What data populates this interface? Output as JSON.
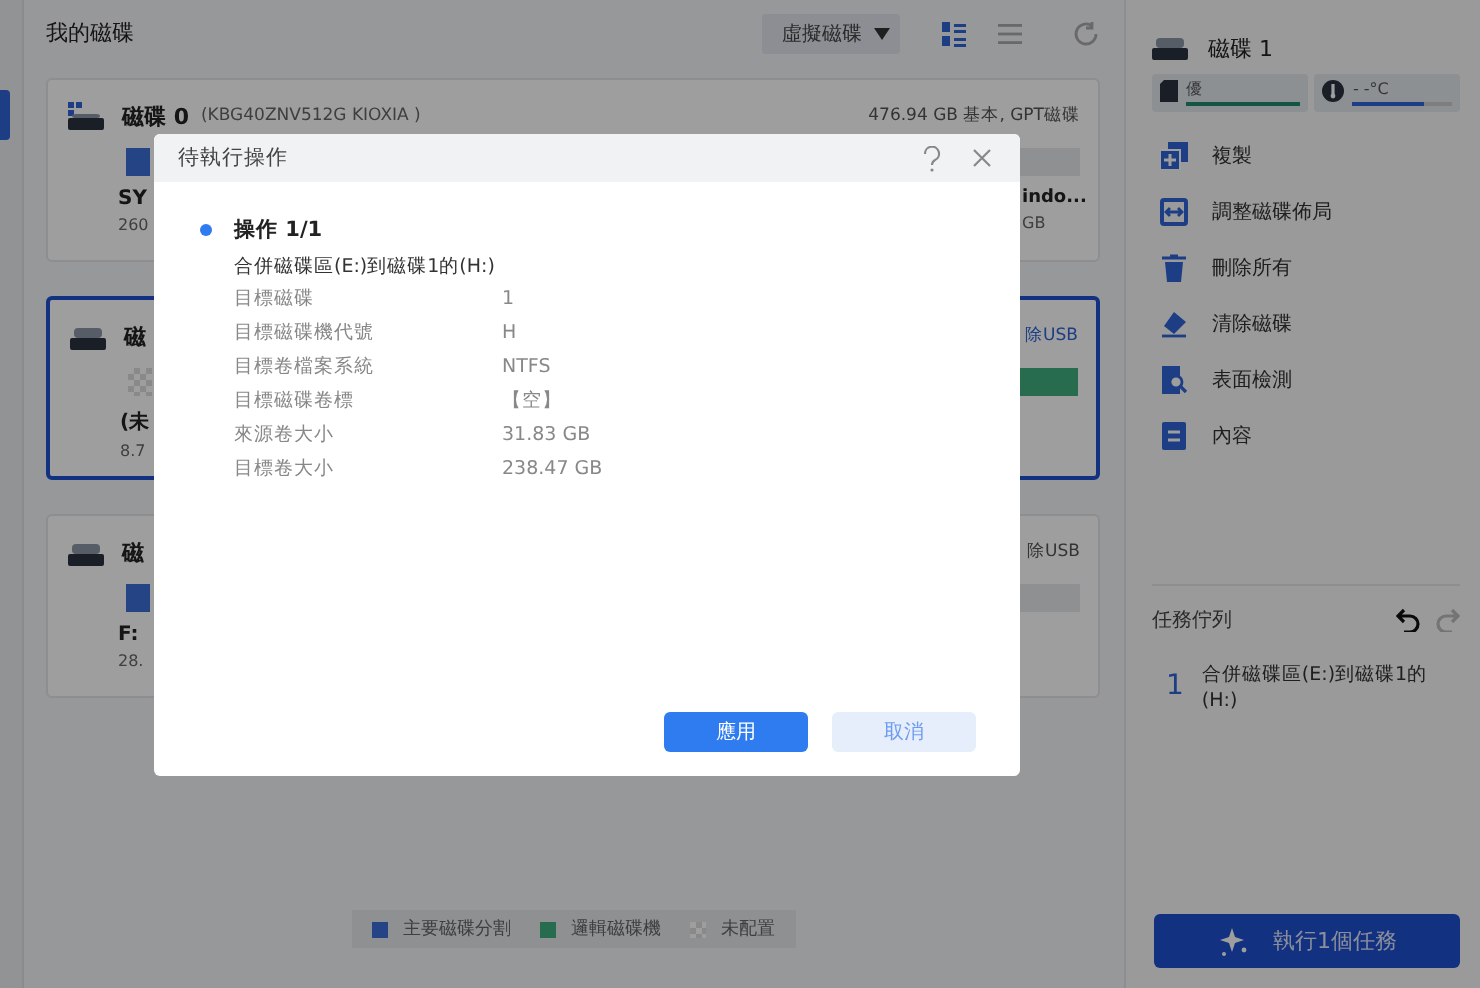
{
  "main": {
    "title": "我的磁碟",
    "view_dropdown": "虛擬磁碟",
    "view_modes": [
      {
        "selected": true
      },
      {
        "selected": false
      }
    ]
  },
  "disks": [
    {
      "name": "磁碟 0",
      "model": "(KBG40ZNV512G KIOXIA )",
      "info": "476.94 GB 基本, GPT磁碟",
      "info_link": false,
      "selected": false,
      "left": {
        "kind": "primary",
        "name": "SY",
        "size": "260"
      },
      "right": {
        "kind": "other",
        "name": "indo...",
        "size": "GB"
      }
    },
    {
      "name": "磁",
      "info": "除USB",
      "info_link": true,
      "selected": true,
      "left": {
        "kind": "unallocated",
        "name": "(未",
        "size": "8.7"
      },
      "right": {
        "kind": "logical"
      }
    },
    {
      "name": "磁",
      "info": "除USB",
      "info_link": false,
      "selected": false,
      "left": {
        "kind": "primary",
        "name": "F:",
        "size": "28."
      },
      "right": {
        "kind": "other"
      }
    }
  ],
  "legend": [
    {
      "kind": "primary",
      "label": "主要磁碟分割"
    },
    {
      "kind": "logical",
      "label": "邏輯磁碟機"
    },
    {
      "kind": "unallocated",
      "label": "未配置"
    }
  ],
  "side_panel": {
    "disk_name": "磁碟 1",
    "health": {
      "label": "優",
      "level": 1
    },
    "temperature": {
      "label": "- -°C",
      "level": 0.72
    },
    "actions": [
      "複製",
      "調整磁碟佈局",
      "刪除所有",
      "清除磁碟",
      "表面檢測",
      "內容"
    ],
    "queue_title": "任務佇列",
    "queue": [
      {
        "number": "1",
        "text": "合併磁碟區(E:)到磁碟1的(H:)"
      }
    ],
    "execute_button": "執行1個任務"
  },
  "dialog": {
    "title": "待執行操作",
    "operation": "操作 1/1",
    "summary": "合併磁碟區(E:)到磁碟1的(H:)",
    "details": [
      {
        "label": "目標磁碟",
        "value": "1"
      },
      {
        "label": "目標磁碟機代號",
        "value": "H"
      },
      {
        "label": "目標卷檔案系統",
        "value": "NTFS"
      },
      {
        "label": "目標磁碟卷標",
        "value": "【空】"
      },
      {
        "label": "來源卷大小",
        "value": "31.83 GB"
      },
      {
        "label": "目標卷大小",
        "value": "238.47 GB"
      }
    ],
    "apply_button": "應用",
    "cancel_button": "取消"
  }
}
